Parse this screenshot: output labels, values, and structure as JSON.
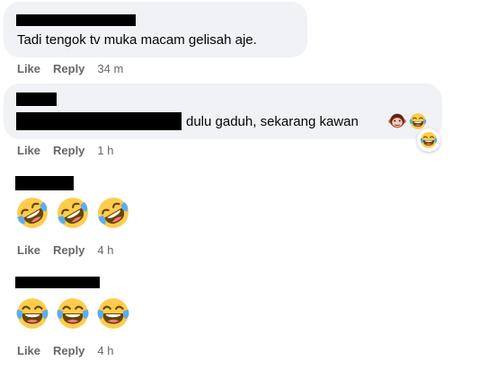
{
  "comments": [
    {
      "text_prefix": "",
      "text": "Tadi tengok tv muka macam gelisah aje.",
      "like": "Like",
      "reply": "Reply",
      "time": "34 m"
    },
    {
      "text": "dulu gaduh, sekarang kawan",
      "like": "Like",
      "reply": "Reply",
      "time": "1 h",
      "emojis": [
        "monkey-face-icon",
        "laughing-tears-icon"
      ],
      "reaction": "laughing-tears-icon"
    },
    {
      "emojis": [
        "rolling-laughing-icon",
        "rolling-laughing-icon",
        "rolling-laughing-icon"
      ],
      "like": "Like",
      "reply": "Reply",
      "time": "4 h"
    },
    {
      "emojis": [
        "laughing-tears-icon",
        "laughing-tears-icon",
        "laughing-tears-icon"
      ],
      "like": "Like",
      "reply": "Reply",
      "time": "4 h"
    }
  ],
  "colors": {
    "bubble": "#f0f2f5",
    "meta": "#65676b",
    "text": "#050505",
    "emoji_yellow": "#ffcc4d",
    "tear_blue": "#5dadec"
  }
}
